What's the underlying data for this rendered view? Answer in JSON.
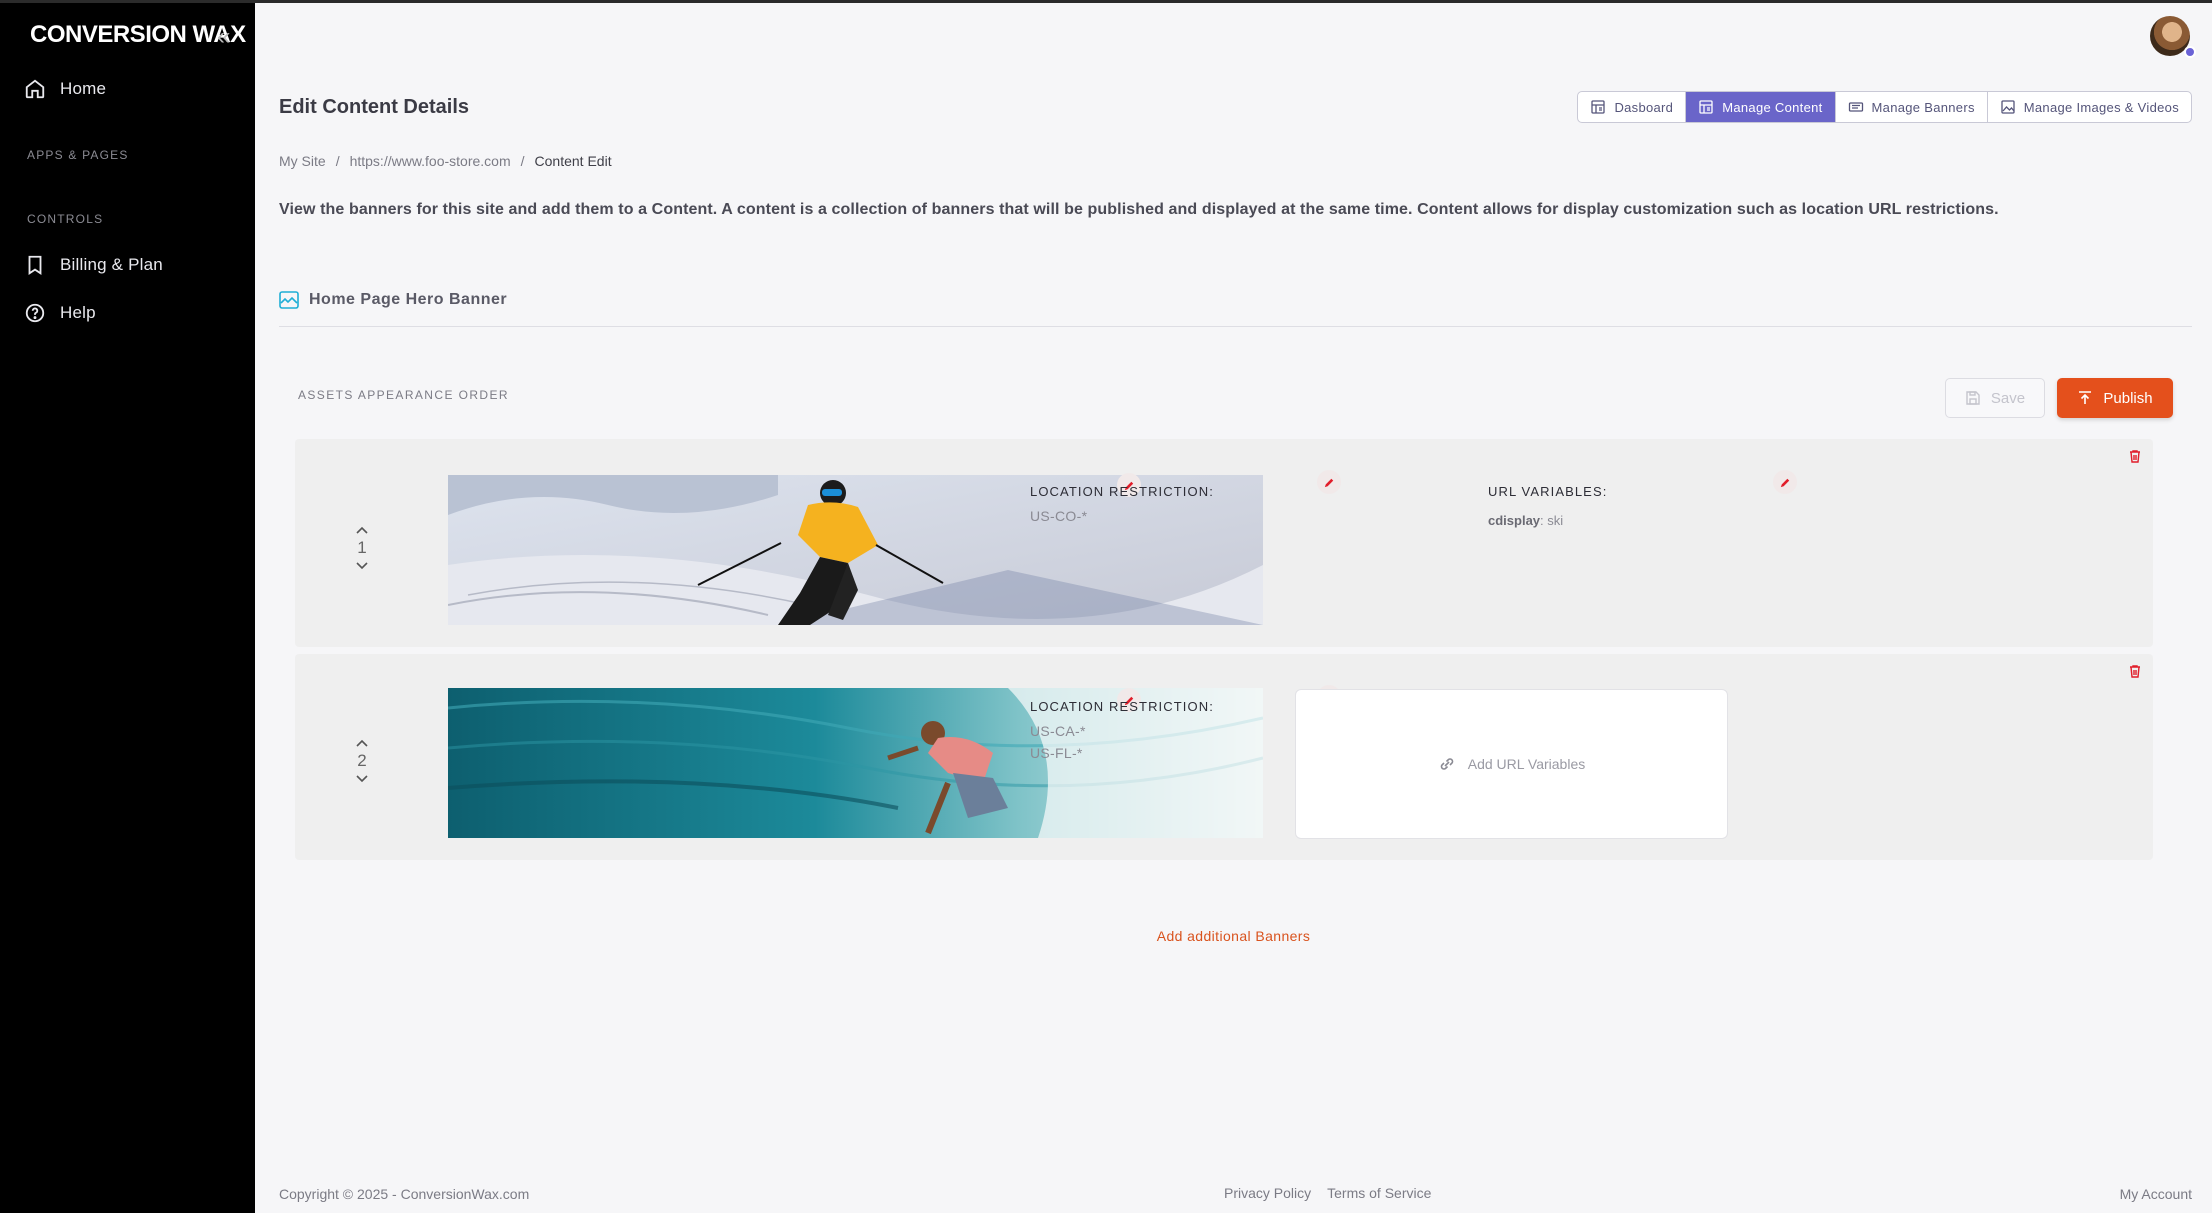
{
  "brand": {
    "logo_text": "CONVERSION WAX"
  },
  "sidebar": {
    "items": [
      {
        "label": "Home",
        "icon": "home-icon"
      },
      {
        "label": "Billing & Plan",
        "icon": "bookmark-icon"
      },
      {
        "label": "Help",
        "icon": "help-circle-icon"
      }
    ],
    "sections": {
      "apps": "APPS & PAGES",
      "controls": "CONTROLS"
    }
  },
  "header": {
    "title": "Edit Content Details",
    "tabs": [
      {
        "label": "Dasboard",
        "active": false
      },
      {
        "label": "Manage Content",
        "active": true
      },
      {
        "label": "Manage Banners",
        "active": false
      },
      {
        "label": "Manage Images & Videos",
        "active": false
      }
    ],
    "breadcrumb": [
      "My Site",
      "https://www.foo-store.com",
      "Content Edit"
    ]
  },
  "description": "View the banners for this site and add them to a Content. A content is a collection of banners that will be published and displayed at the same time. Content allows for display customization such as location URL restrictions.",
  "content": {
    "section_title": "Home Page Hero Banner",
    "order_label": "ASSETS APPEARANCE ORDER",
    "save_label": "Save",
    "publish_label": "Publish",
    "location_label": "LOCATION RESTRICTION:",
    "url_label": "URL VARIABLES:",
    "rows": [
      {
        "order": "1",
        "locations": [
          "US-CO-*"
        ],
        "url_key": "cdisplay",
        "url_value": ": ski"
      },
      {
        "order": "2",
        "locations": [
          "US-CA-*",
          "US-FL-*"
        ],
        "add_url_label": "Add URL Variables"
      }
    ],
    "add_banners_label": "Add additional Banners"
  },
  "footer": {
    "copyright": "Copyright © 2025 -  ConversionWax.com",
    "privacy": "Privacy Policy",
    "terms": "Terms of Service",
    "account": "My Account"
  },
  "colors": {
    "accent": "#6a65c9",
    "publish": "#e4501c",
    "sidebar_bg": "#000000"
  }
}
